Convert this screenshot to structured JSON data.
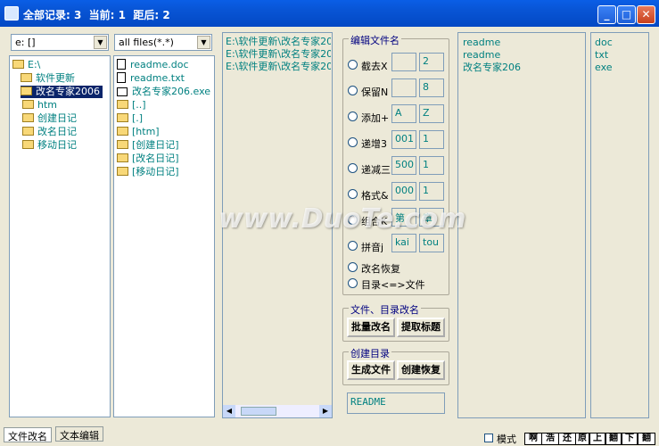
{
  "window": {
    "title": "全部记录: 3  当前: 1  距后: 2"
  },
  "drive": {
    "value": "e: []"
  },
  "filter": {
    "value": "all files(*.*)"
  },
  "tree": {
    "items": [
      "E:\\",
      "软件更新",
      "改名专家2006",
      "htm",
      "创建日记",
      "改名日记",
      "移动日记"
    ]
  },
  "files": {
    "items": [
      "readme.doc",
      "readme.txt",
      "改名专家206.exe",
      "[..]",
      "[.]",
      "[htm]",
      "[创建日记]",
      "[改名日记]",
      "[移动日记]"
    ]
  },
  "paths": {
    "items": [
      "E:\\软件更新\\改名专家20",
      "E:\\软件更新\\改名专家20",
      "E:\\软件更新\\改名专家20"
    ]
  },
  "edit_group": {
    "caption": "编辑文件名",
    "options": [
      {
        "label": "截去X",
        "a": "",
        "b": "2"
      },
      {
        "label": "保留N",
        "a": "",
        "b": "8"
      },
      {
        "label": "添加+",
        "a": "A",
        "b": "Z"
      },
      {
        "label": "递增3",
        "a": "001",
        "b": "1"
      },
      {
        "label": "递减三",
        "a": "500",
        "b": "1"
      },
      {
        "label": "格式&",
        "a": "000",
        "b": "1"
      },
      {
        "label": "组合K",
        "a": "第",
        "b": "章"
      },
      {
        "label": "拼音j",
        "a": "kai",
        "b": "tou"
      }
    ],
    "restore": "改名恢复",
    "dir_file": "目录<=>文件"
  },
  "rename_group": {
    "caption": "文件、目录改名",
    "batch": "批量改名",
    "extract": "提取标题"
  },
  "create_group": {
    "caption": "创建目录",
    "gen": "生成文件",
    "restore": "创建恢复"
  },
  "readme_box": {
    "value": "README"
  },
  "names": {
    "items": [
      "readme",
      "readme",
      "改名专家206"
    ]
  },
  "exts": {
    "items": [
      "doc",
      "txt",
      "exe"
    ]
  },
  "tabs": {
    "rename": "文件改名",
    "text_edit": "文本编辑"
  },
  "status": {
    "mode": "模式",
    "b1": "啊",
    "b2": "浩",
    "b3": "还",
    "b4": "原",
    "b5": "上",
    "b6": "翻",
    "b7": "下",
    "b8": "翻"
  },
  "watermark": {
    "text": "www.DuoTe.com"
  }
}
